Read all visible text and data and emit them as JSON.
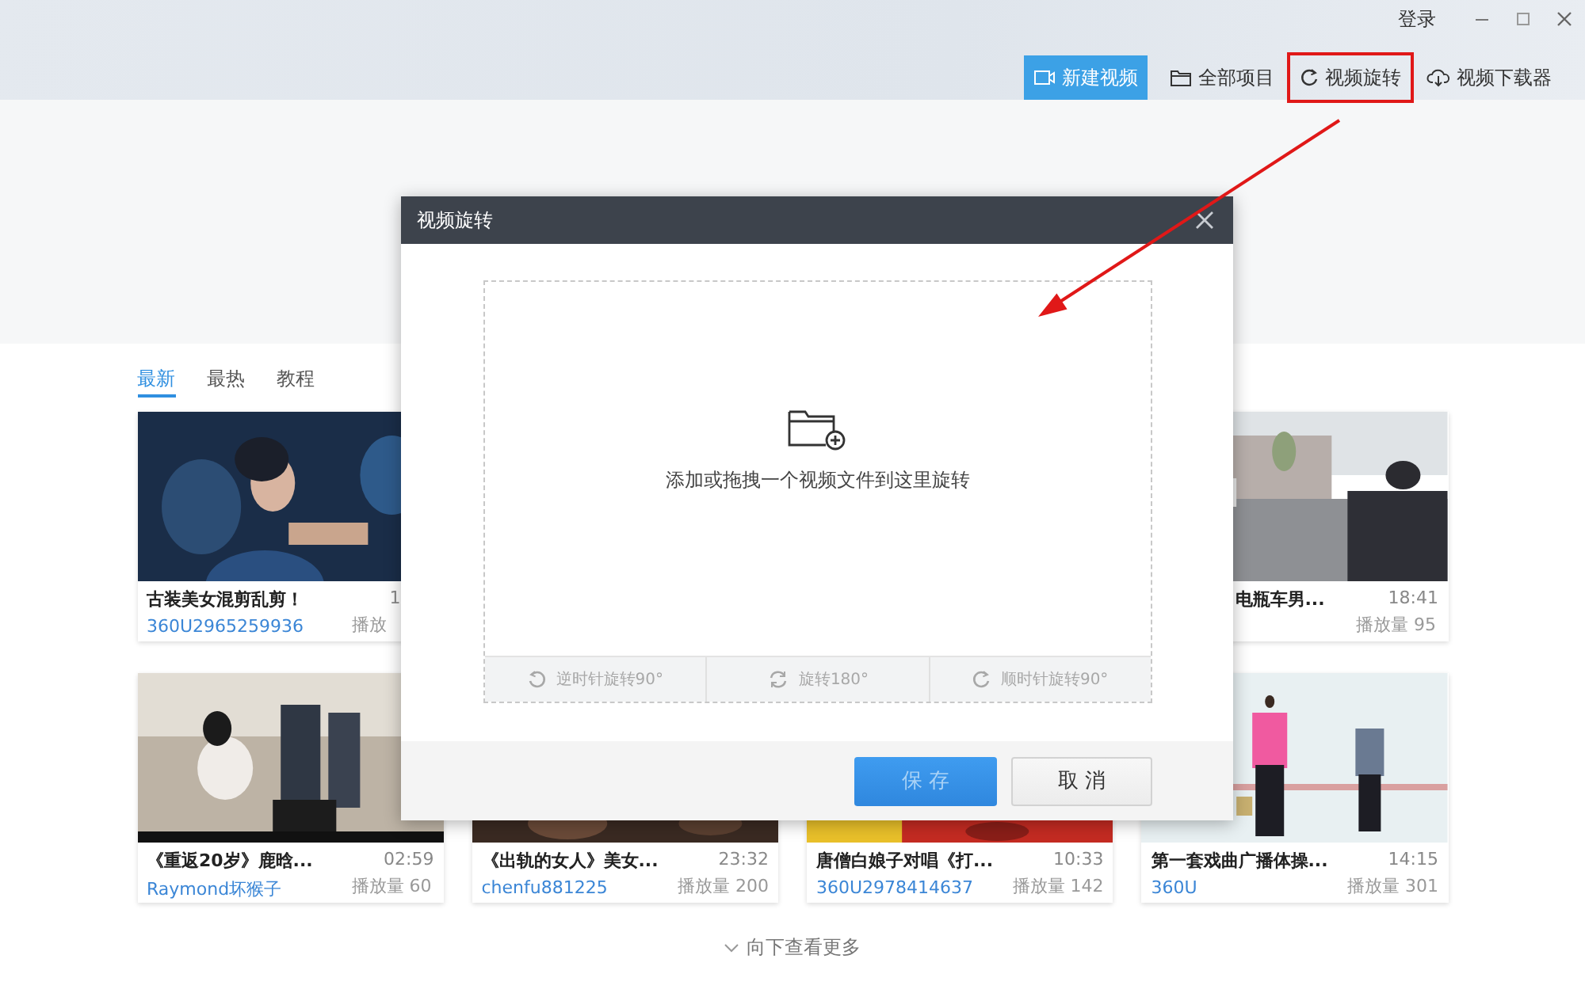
{
  "header": {
    "login": "登录"
  },
  "toolbar": [
    {
      "label": "新建视频",
      "kind": "primary",
      "highlighted": false
    },
    {
      "label": "全部项目",
      "kind": "plain",
      "highlighted": false
    },
    {
      "label": "视频旋转",
      "kind": "plain",
      "highlighted": true
    },
    {
      "label": "视频下载器",
      "kind": "plain",
      "highlighted": false
    }
  ],
  "tabs": [
    {
      "label": "最新",
      "selected": true
    },
    {
      "label": "最热",
      "selected": false
    },
    {
      "label": "教程",
      "selected": false
    }
  ],
  "videos": [
    {
      "title": "古装美女混剪乱剪！",
      "duration": "1",
      "uploader": "360U2965259936",
      "plays": "播放"
    },
    {
      "title": "电瓶车男...",
      "duration": "18:41",
      "plays": "播放量 95"
    },
    {
      "title": "《重返20岁》鹿晗...",
      "duration": "02:59",
      "uploader": "Raymond坏猴子",
      "plays": "播放量 60"
    },
    {
      "title": "《出轨的女人》美女...",
      "duration": "23:32",
      "uploader": "chenfu881225",
      "plays": "播放量 200"
    },
    {
      "title": "唐僧白娘子对唱《打...",
      "duration": "10:33",
      "uploader": "360U2978414637",
      "plays": "播放量 142"
    },
    {
      "title": "第一套戏曲广播体操...",
      "duration": "14:15",
      "uploader": "360U",
      "plays": "播放量 301"
    }
  ],
  "more": "向下查看更多",
  "dialog": {
    "title": "视频旋转",
    "drop_hint": "添加或拖拽一个视频文件到这里旋转",
    "rotate_buttons": [
      {
        "label": "逆时针旋转90°",
        "disabled": true
      },
      {
        "label": "旋转180°",
        "disabled": true
      },
      {
        "label": "顺时针旋转90°",
        "disabled": true
      }
    ],
    "save": {
      "label": "保 存",
      "disabled": true
    },
    "cancel": {
      "label": "取 消",
      "disabled": false
    }
  }
}
